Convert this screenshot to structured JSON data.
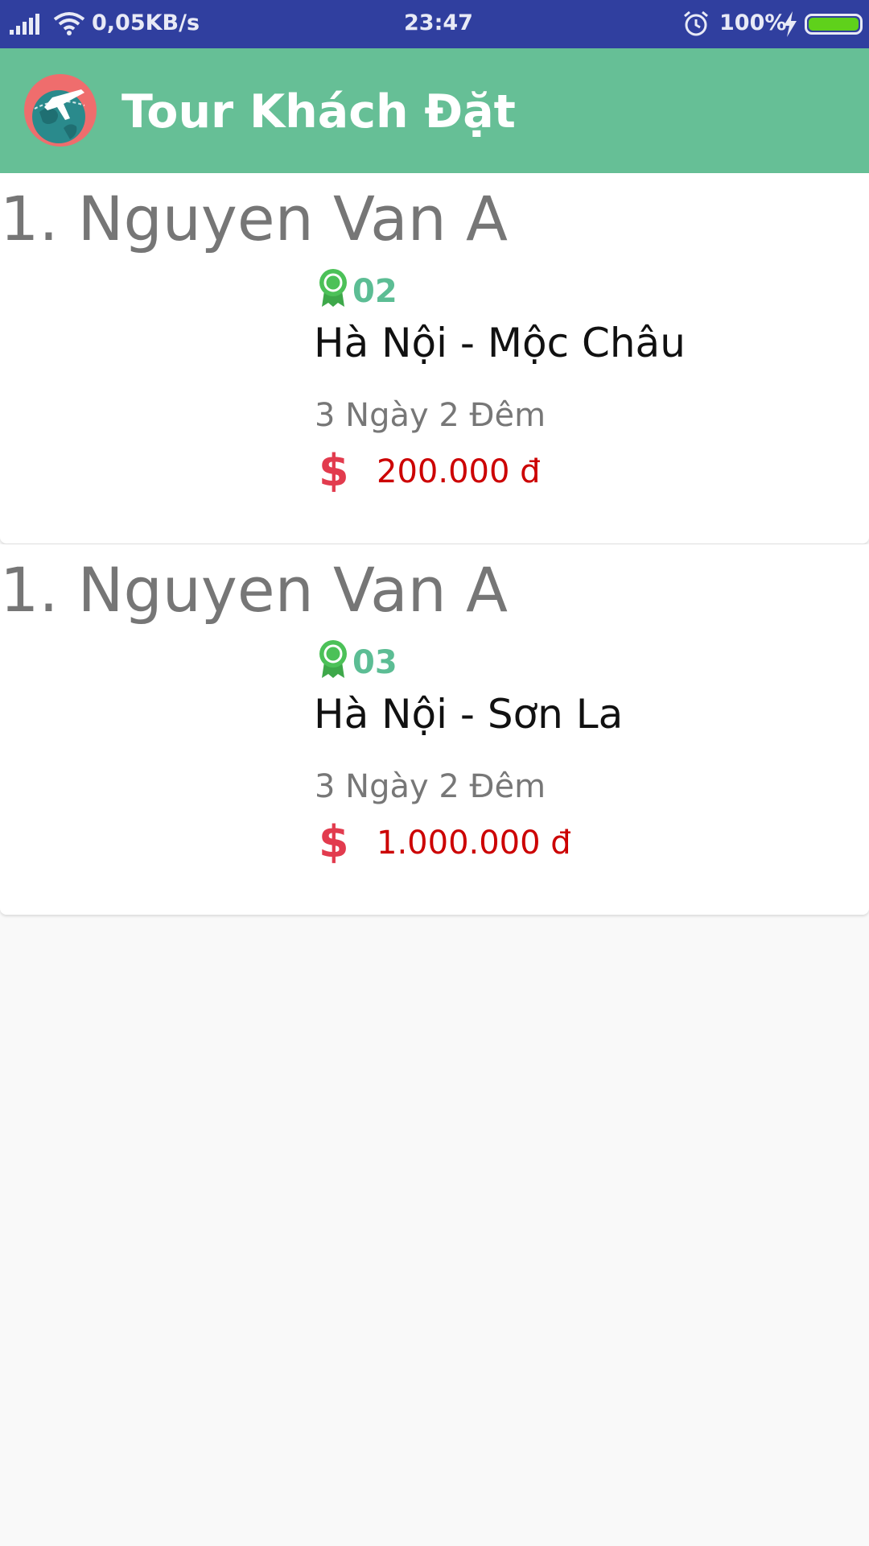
{
  "status_bar": {
    "network_speed": "0,05KB/s",
    "time": "23:47",
    "battery_percent": "100%",
    "battery_level": 1.0,
    "signal_icon": "signal-icon",
    "wifi_icon": "wifi-icon",
    "alarm_icon": "alarm-icon",
    "charging_icon": "charging-icon"
  },
  "app_bar": {
    "title": "Tour Khách Đặt",
    "logo_icon": "globe-airplane-logo-icon",
    "background_color": "#66bf96"
  },
  "bookings": [
    {
      "customer": "1. Nguyen Van A",
      "tour_id": "02",
      "tour_name": "Hà Nội - Mộc Châu",
      "duration": "3 Ngày 2 Đêm",
      "price": "200.000 đ"
    },
    {
      "customer": "1. Nguyen Van A",
      "tour_id": "03",
      "tour_name": "Hà Nội - Sơn La",
      "duration": "3 Ngày 2 Đêm",
      "price": "1.000.000 đ"
    }
  ],
  "icons": {
    "badge": "award-badge-icon",
    "price": "dollar-icon",
    "dollar_glyph": "$"
  },
  "colors": {
    "status_bar": "#303f9f",
    "accent_green": "#5cbd94",
    "price_red": "#cc0000",
    "dollar_red": "#e23b4e"
  }
}
